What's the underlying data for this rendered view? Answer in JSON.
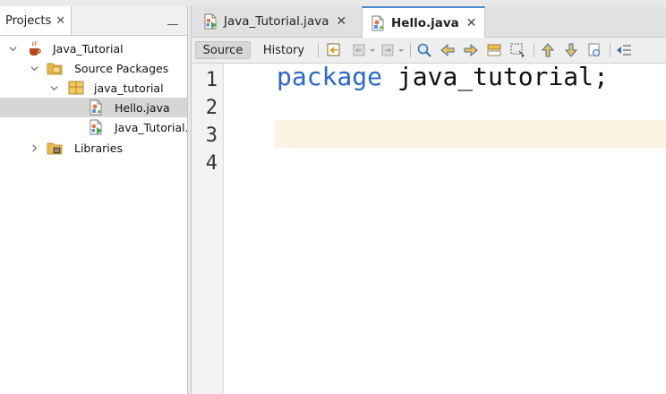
{
  "projects_panel": {
    "tab_label": "Projects",
    "tree": [
      {
        "label": "Java_Tutorial",
        "icon": "coffee-cup-icon"
      },
      {
        "label": "Source Packages",
        "icon": "source-packages-icon"
      },
      {
        "label": "java_tutorial",
        "icon": "package-icon"
      },
      {
        "label": "Hello.java",
        "icon": "java-file-icon"
      },
      {
        "label": "Java_Tutorial.java",
        "icon": "java-main-file-icon"
      },
      {
        "label": "Libraries",
        "icon": "libraries-icon"
      }
    ]
  },
  "editor": {
    "tabs": [
      {
        "label": "Java_Tutorial.java"
      },
      {
        "label": "Hello.java"
      }
    ],
    "toolbar": {
      "source_label": "Source",
      "history_label": "History"
    },
    "line_numbers": [
      "1",
      "2",
      "3",
      "4"
    ],
    "code": {
      "line1_keyword": "package",
      "line1_rest": " java_tutorial;"
    }
  },
  "colors": {
    "keyword": "#2e67c6",
    "current_line": "#fbf4e2",
    "active_tab_accent": "#4a88c7"
  }
}
